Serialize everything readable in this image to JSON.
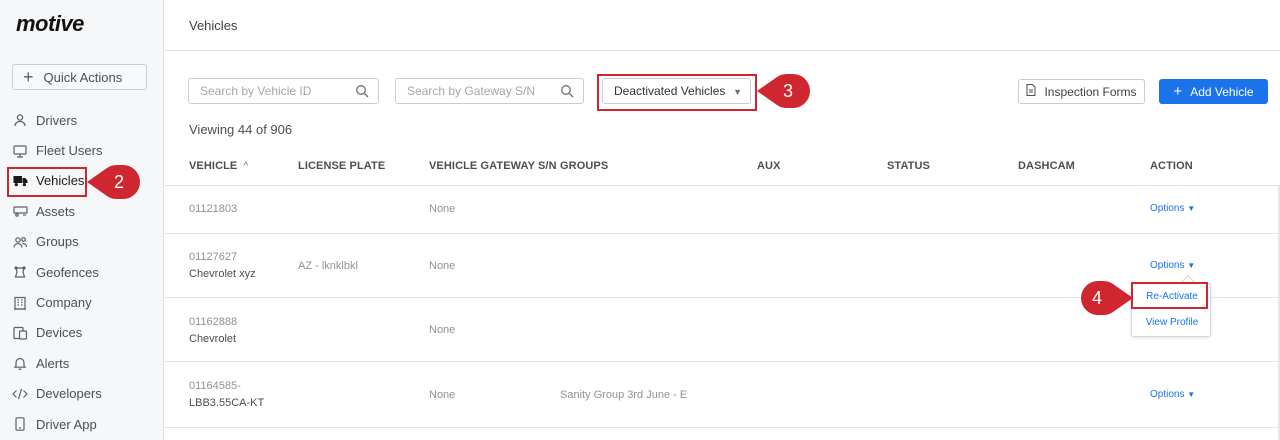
{
  "brand": {
    "logo": "motive"
  },
  "sidebar": {
    "quick_actions": "Quick Actions",
    "items": [
      {
        "label": "Drivers",
        "icon": "person-icon"
      },
      {
        "label": "Fleet Users",
        "icon": "monitor-icon"
      },
      {
        "label": "Vehicles",
        "icon": "truck-icon",
        "active": true
      },
      {
        "label": "Assets",
        "icon": "trailer-icon"
      },
      {
        "label": "Groups",
        "icon": "group-icon"
      },
      {
        "label": "Geofences",
        "icon": "geofence-icon"
      },
      {
        "label": "Company",
        "icon": "building-icon"
      },
      {
        "label": "Devices",
        "icon": "devices-icon"
      },
      {
        "label": "Alerts",
        "icon": "bell-icon"
      },
      {
        "label": "Developers",
        "icon": "code-icon"
      },
      {
        "label": "Driver App",
        "icon": "phone-icon"
      }
    ]
  },
  "header": {
    "title": "Vehicles"
  },
  "toolbar": {
    "search_vehicle_placeholder": "Search by Vehicle ID",
    "search_gateway_placeholder": "Search by Gateway S/N",
    "filter_value": "Deactivated Vehicles",
    "inspection_forms": "Inspection Forms",
    "add_vehicle": "Add Vehicle"
  },
  "viewing": "Viewing 44 of 906",
  "table": {
    "columns": [
      "VEHICLE",
      "LICENSE PLATE",
      "VEHICLE GATEWAY S/N",
      "GROUPS",
      "AUX",
      "STATUS",
      "DASHCAM",
      "ACTION"
    ],
    "rows": [
      {
        "vehicle": "01121803",
        "subtitle": "",
        "plate": "",
        "gateway": "None",
        "groups": "",
        "action": "Options"
      },
      {
        "vehicle": "01127627",
        "subtitle": "Chevrolet xyz",
        "plate": "AZ - lknklbkl",
        "gateway": "None",
        "groups": "",
        "action": "Options"
      },
      {
        "vehicle": "01162888",
        "subtitle": "Chevrolet",
        "plate": "",
        "gateway": "None",
        "groups": "",
        "action": ""
      },
      {
        "vehicle": "01164585-",
        "subtitle": "LBB3.55CA-KT",
        "plate": "",
        "gateway": "None",
        "groups": "Sanity Group 3rd June - E",
        "action": "Options"
      }
    ]
  },
  "options_menu": {
    "items": [
      "Re-Activate",
      "View Profile"
    ]
  },
  "annotations": {
    "step2": "2",
    "step3": "3",
    "step4": "4"
  },
  "colors": {
    "accent": "#1a73e8",
    "callout": "#d0262f"
  }
}
